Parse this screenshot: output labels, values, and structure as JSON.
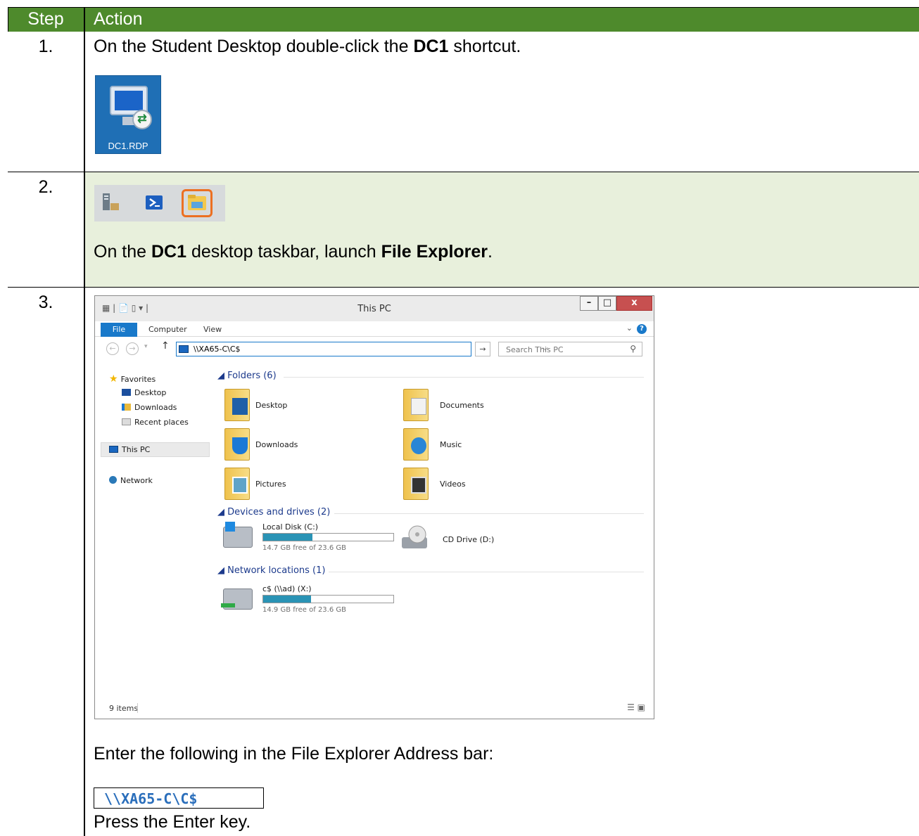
{
  "table": {
    "header_step": "Step",
    "header_action": "Action"
  },
  "steps": [
    {
      "number": "1.",
      "text_pre": "On the Student Desktop double-click the ",
      "text_bold": "DC1",
      "text_post": " shortcut.",
      "shortcut_label": "DC1.RDP"
    },
    {
      "number": "2.",
      "text_pre": "On the ",
      "text_bold1": "DC1",
      "text_mid": " desktop taskbar, launch ",
      "text_bold2": "File Explorer",
      "text_post": "."
    },
    {
      "number": "3.",
      "text_enter": "Enter the following in the File Explorer Address bar:",
      "command": "\\\\XA65-C\\C$",
      "text_press": "Press the Enter key."
    }
  ],
  "explorer": {
    "title": "This PC",
    "tabs": [
      "File",
      "Computer",
      "View"
    ],
    "address": "\\\\XA65-C\\C$",
    "search_placeholder": "Search This PC",
    "nav": {
      "favorites": "Favorites",
      "desktop": "Desktop",
      "downloads": "Downloads",
      "recent": "Recent places",
      "this_pc": "This PC",
      "network": "Network"
    },
    "groups": {
      "folders": "Folders (6)",
      "devices": "Devices and drives (2)",
      "network": "Network locations (1)"
    },
    "folders": [
      "Desktop",
      "Documents",
      "Downloads",
      "Music",
      "Pictures",
      "Videos"
    ],
    "drives": [
      {
        "name": "Local Disk (C:)",
        "free": "14.7 GB free of 23.6 GB",
        "used_fraction": 0.38
      },
      {
        "name": "CD Drive (D:)"
      }
    ],
    "network_drives": [
      {
        "name": "c$ (\\\\ad) (X:)",
        "free": "14.9 GB free of 23.6 GB",
        "used_fraction": 0.37
      }
    ],
    "status": "9 items"
  },
  "colors": {
    "header_bg": "#4e8a2c",
    "row2_bg": "#e8f0dc",
    "highlight_orange": "#ec7022",
    "command_blue": "#2a6ebb"
  }
}
